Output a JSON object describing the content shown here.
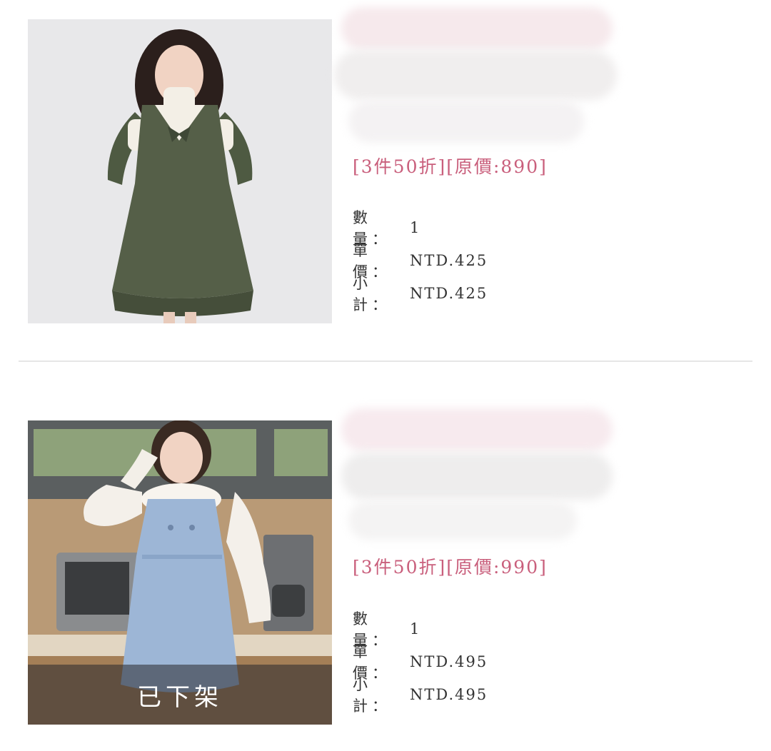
{
  "cart_items": [
    {
      "promo_text": "[3件50折][原價:890]",
      "quantity_label": "數量：",
      "quantity_value": "1",
      "unit_price_label": "單價：",
      "unit_price_value": "NTD.425",
      "subtotal_label": "小計：",
      "subtotal_value": "NTD.425",
      "image_subject": "olive-green-dress-photo"
    },
    {
      "promo_text": "[3件50折][原價:990]",
      "quantity_label": "數量：",
      "quantity_value": "1",
      "unit_price_label": "單價：",
      "unit_price_value": "NTD.495",
      "subtotal_label": "小計：",
      "subtotal_value": "NTD.495",
      "status_label": "已下架",
      "image_subject": "blue-pinafore-dress-photo"
    }
  ],
  "colors": {
    "promo": "#c95f7c",
    "text": "#333333",
    "divider": "#e6e6e6"
  }
}
